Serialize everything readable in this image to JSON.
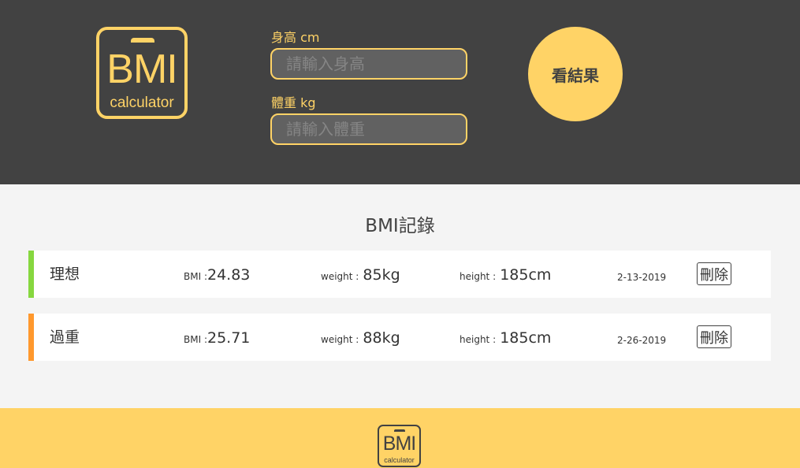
{
  "logo": {
    "title": "BMI",
    "subtitle": "calculator"
  },
  "form": {
    "height": {
      "label": "身高 cm",
      "placeholder": "請輸入身高",
      "value": ""
    },
    "weight": {
      "label": "體重 kg",
      "placeholder": "請輸入體重",
      "value": ""
    },
    "submit_label": "看結果"
  },
  "records": {
    "title": "BMI記錄",
    "bmi_key": "BMI :",
    "weight_key": "weight :",
    "height_key": "height :",
    "delete_label": "刪除",
    "items": [
      {
        "status": "理想",
        "bmi": "24.83",
        "weight": "85kg",
        "height": "185cm",
        "date": "2-13-2019",
        "color": "#86d73f"
      },
      {
        "status": "過重",
        "bmi": "25.71",
        "weight": "88kg",
        "height": "185cm",
        "date": "2-26-2019",
        "color": "#ff982d"
      }
    ]
  },
  "footer": {
    "logo_title": "BMI",
    "logo_subtitle": "calculator"
  },
  "colors": {
    "accent": "#ffd366",
    "header_bg": "#424242",
    "page_bg": "#f4f4f4",
    "ideal": "#86d73f",
    "overweight": "#ff982d"
  }
}
